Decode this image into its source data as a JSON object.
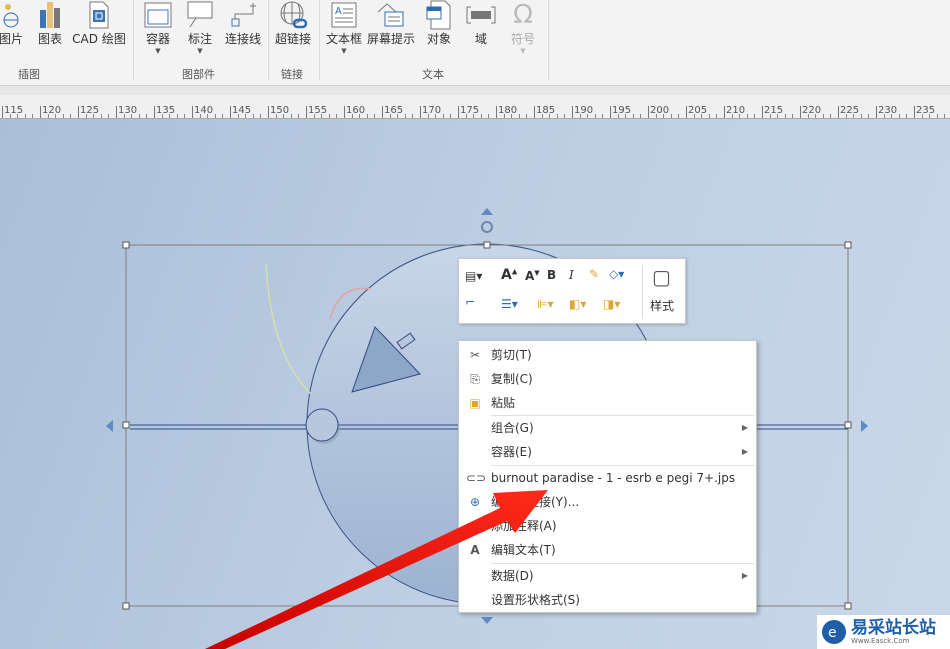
{
  "ribbon": {
    "buttons": [
      {
        "label": "图片",
        "icon": "picture-icon"
      },
      {
        "label": "图表",
        "icon": "chart-icon"
      },
      {
        "label": "CAD 绘图",
        "icon": "cad-icon"
      },
      {
        "label": "容器",
        "icon": "container-icon"
      },
      {
        "label": "标注",
        "icon": "callout-icon"
      },
      {
        "label": "连接线",
        "icon": "connector-icon"
      },
      {
        "label": "超链接",
        "icon": "hyperlink-icon"
      },
      {
        "label": "文本框",
        "icon": "textbox-icon"
      },
      {
        "label": "屏幕提示",
        "icon": "screentip-icon"
      },
      {
        "label": "对象",
        "icon": "object-icon"
      },
      {
        "label": "域",
        "icon": "field-icon"
      },
      {
        "label": "符号",
        "icon": "omega-icon"
      }
    ],
    "groups": [
      "插图",
      "图部件",
      "链接",
      "文本"
    ]
  },
  "ruler": {
    "labels": [
      "115",
      "120",
      "125",
      "130",
      "135",
      "140",
      "145",
      "150",
      "155",
      "160",
      "165",
      "170",
      "175",
      "180",
      "185",
      "190",
      "195",
      "200",
      "205",
      "210",
      "215",
      "220",
      "225",
      "230",
      "235"
    ]
  },
  "mini_toolbar": {
    "style_label": "样式"
  },
  "context_menu": {
    "items": [
      {
        "label": "剪切(T)",
        "icon": "scissors-icon"
      },
      {
        "label": "复制(C)",
        "icon": "copy-icon"
      },
      {
        "label": "粘贴",
        "icon": "paste-icon"
      },
      {
        "label": "组合(G)",
        "submenu": true
      },
      {
        "label": "容器(E)",
        "submenu": true
      },
      {
        "label": "burnout paradise - 1 - esrb e pegi 7+.jps",
        "icon": "link-icon"
      },
      {
        "label": "编辑超链接(Y)...",
        "icon": "globe-link-icon"
      },
      {
        "label": "添加注释(A)",
        "icon": "comment-icon"
      },
      {
        "label": "编辑文本(T)",
        "icon": "text-a-icon"
      },
      {
        "label": "数据(D)",
        "submenu": true
      },
      {
        "label": "设置形状格式(S)"
      }
    ]
  },
  "watermark": {
    "text": "易采站长站",
    "sub": "Www.Easck.Com"
  },
  "colors": {
    "arrow": "#e8140f",
    "canvas": "#b4c6dc",
    "accent": "#2e6db4"
  }
}
